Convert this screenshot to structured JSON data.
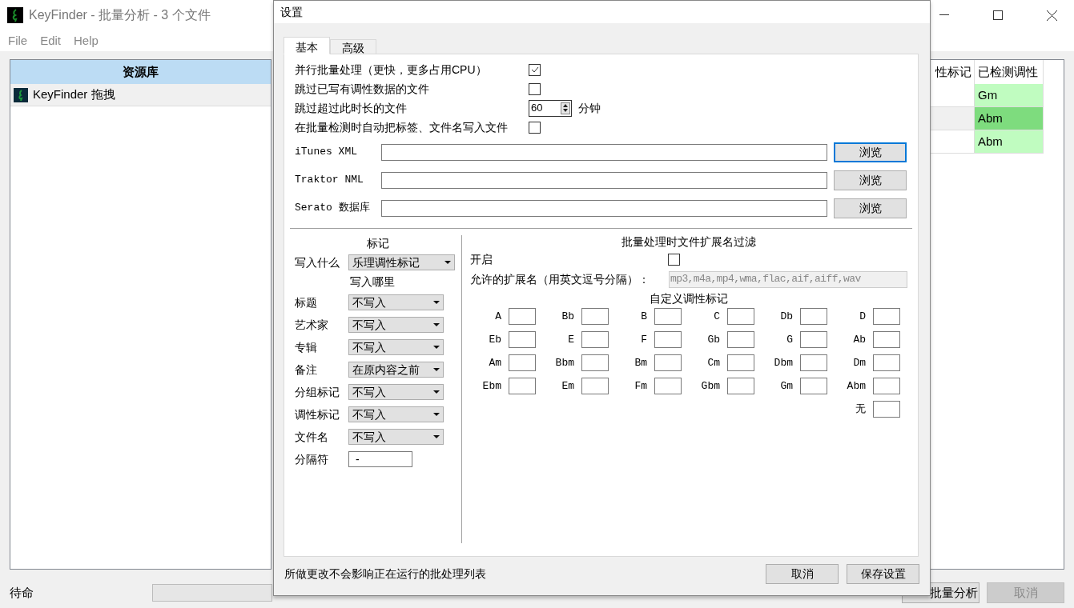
{
  "main_window": {
    "title": "KeyFinder - 批量分析 - 3 个文件",
    "menu": [
      "File",
      "Edit",
      "Help"
    ],
    "library": {
      "header": "资源库",
      "items": [
        {
          "label": "KeyFinder 拖拽",
          "selected": true
        }
      ]
    },
    "table": {
      "columns": [
        "性标记",
        "已检测调性"
      ],
      "rows": [
        {
          "cells": [
            "",
            "Gm"
          ],
          "selected": false
        },
        {
          "cells": [
            "",
            "Abm"
          ],
          "selected": true
        },
        {
          "cells": [
            "",
            "Abm"
          ],
          "selected": false
        }
      ]
    },
    "status": "待命",
    "progress": {
      "level": 0
    },
    "buttons": [
      {
        "label": "批量分析",
        "disabled": false
      },
      {
        "label": "取消",
        "disabled": true
      }
    ]
  },
  "dialog": {
    "title": "设置",
    "tabs": [
      {
        "label": "基本",
        "selected": true
      },
      {
        "label": "高级",
        "selected": false
      }
    ],
    "options": [
      {
        "kind": "checkbox",
        "label": "并行批量处理（更快，更多占用CPU）",
        "checked": true
      },
      {
        "kind": "checkbox",
        "label": "跳过已写有调性数据的文件",
        "checked": false
      },
      {
        "kind": "spin",
        "label": "跳过超过此时长的文件",
        "value": "60",
        "unit": "分钟"
      },
      {
        "kind": "checkbox",
        "label": "在批量检测时自动把标签、文件名写入文件",
        "checked": false
      }
    ],
    "paths": [
      {
        "label": "iTunes XML",
        "button": "浏览",
        "focused": true
      },
      {
        "label": "Traktor NML",
        "button": "浏览",
        "focused": false
      },
      {
        "label": "Serato 数据库",
        "button": "浏览",
        "focused": false
      }
    ],
    "tags": {
      "title": "标记",
      "write_what": {
        "label": "写入什么",
        "value": "乐理调性标记"
      },
      "where_title": "写入哪里",
      "fields": [
        {
          "label": "标题",
          "value": "不写入"
        },
        {
          "label": "艺术家",
          "value": "不写入"
        },
        {
          "label": "专辑",
          "value": "不写入"
        },
        {
          "label": "备注",
          "value": "在原内容之前"
        },
        {
          "label": "分组标记",
          "value": "不写入"
        },
        {
          "label": "调性标记",
          "value": "不写入"
        },
        {
          "label": "文件名",
          "value": "不写入"
        }
      ],
      "separator": {
        "label": "分隔符",
        "value": "-"
      }
    },
    "filter": {
      "title": "批量处理时文件扩展名过滤",
      "enable": {
        "label": "开启",
        "checked": false
      },
      "extensions": {
        "label": "允许的扩展名（用英文逗号分隔）：",
        "value": "mp3,m4a,mp4,wma,flac,aif,aiff,wav",
        "disabled": true
      }
    },
    "custom_keys": {
      "title": "自定义调性标记",
      "keys": [
        "A",
        "Bb",
        "B",
        "C",
        "Db",
        "D",
        "Eb",
        "E",
        "F",
        "Gb",
        "G",
        "Ab",
        "Am",
        "Bbm",
        "Bm",
        "Cm",
        "Dbm",
        "Dm",
        "Ebm",
        "Em",
        "Fm",
        "Gbm",
        "Gm",
        "Abm",
        "无"
      ]
    },
    "footer": {
      "note": "所做更改不会影响正在运行的批处理列表",
      "buttons": [
        "取消",
        "保存设置"
      ]
    }
  }
}
